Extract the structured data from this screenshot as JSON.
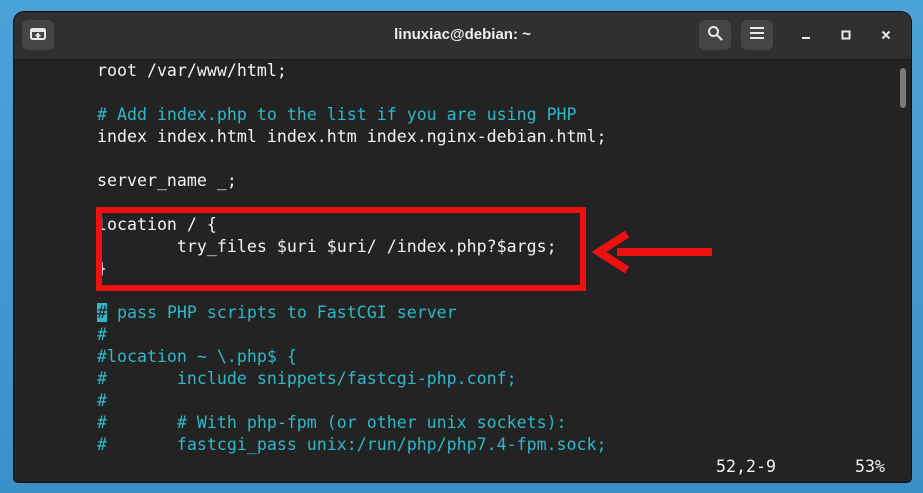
{
  "window": {
    "title": "linuxiac@debian: ~"
  },
  "toolbar": {
    "new_tab_icon": "new-tab-icon",
    "search_icon": "search-icon",
    "menu_icon": "hamburger-menu-icon",
    "minimize_icon": "minimize-icon",
    "maximize_icon": "maximize-icon",
    "close_icon": "close-icon"
  },
  "terminal": {
    "lines": {
      "l1": "root /var/www/html;",
      "l2": "",
      "l3": "# Add index.php to the list if you are using PHP",
      "l4": "index index.html index.htm index.nginx-debian.html;",
      "l5": "",
      "l6": "server_name _;",
      "l7": "",
      "l8": "location / {",
      "l9": "        try_files $uri $uri/ /index.php?$args;",
      "l10": "}",
      "l11": "",
      "l12_cursor": "#",
      "l12_rest": " pass PHP scripts to FastCGI server",
      "l13": "#",
      "l14": "#location ~ \\.php$ {",
      "l15": "#       include snippets/fastcgi-php.conf;",
      "l16": "#",
      "l17": "#       # With php-fpm (or other unix sockets):",
      "l18": "#       fastcgi_pass unix:/run/php/php7.4-fpm.sock;"
    },
    "status": {
      "position": "52,2-9",
      "percent": "53%"
    }
  },
  "colors": {
    "comment": "#2fb8c7",
    "annotation": "#ee1111",
    "background": "#232323",
    "text": "#f2f2f2"
  }
}
